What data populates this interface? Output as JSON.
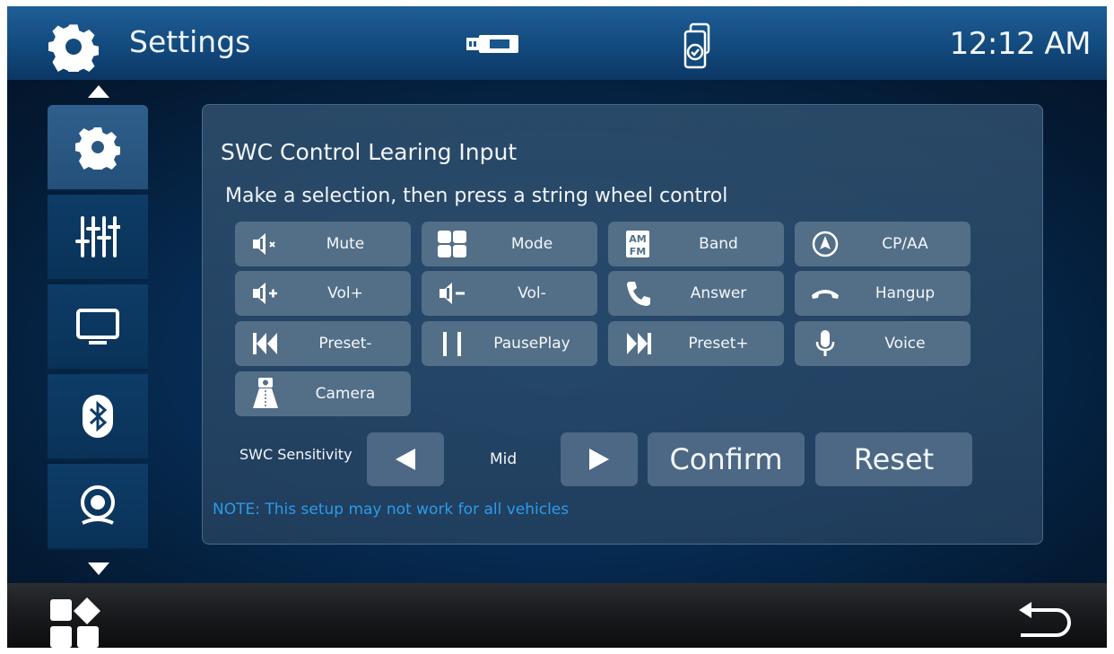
{
  "header": {
    "title": "Settings",
    "time": "12:12 AM",
    "icons": [
      "gear-icon",
      "usb-icon",
      "phone-link-icon"
    ]
  },
  "left_nav": {
    "items": [
      {
        "icon": "gear-icon",
        "active": true
      },
      {
        "icon": "equalizer-icon",
        "active": false
      },
      {
        "icon": "display-icon",
        "active": false
      },
      {
        "icon": "bluetooth-icon",
        "active": false
      },
      {
        "icon": "camera-icon",
        "active": false
      }
    ]
  },
  "panel": {
    "title": "SWC Control Learing Input",
    "subtitle": "Make a selection, then press a string wheel control",
    "buttons": [
      {
        "label": "Mute",
        "icon": "mute-icon"
      },
      {
        "label": "Mode",
        "icon": "mode-icon"
      },
      {
        "label": "Band",
        "icon": "am-fm-icon"
      },
      {
        "label": "CP/AA",
        "icon": "navigation-icon"
      },
      {
        "label": "Vol+",
        "icon": "volume-up-icon"
      },
      {
        "label": "Vol-",
        "icon": "volume-down-icon"
      },
      {
        "label": "Answer",
        "icon": "phone-answer-icon"
      },
      {
        "label": "Hangup",
        "icon": "phone-hangup-icon"
      },
      {
        "label": "Preset-",
        "icon": "skip-back-icon"
      },
      {
        "label": "PausePlay",
        "icon": "pause-icon"
      },
      {
        "label": "Preset+",
        "icon": "skip-forward-icon"
      },
      {
        "label": "Voice",
        "icon": "microphone-icon"
      },
      {
        "label": "Camera",
        "icon": "rear-camera-icon"
      }
    ],
    "sensitivity": {
      "label": "SWC Sensitivity",
      "value": "Mid"
    },
    "confirm_label": "Confirm",
    "reset_label": "Reset",
    "note": "NOTE: This setup may not work for all vehicles"
  },
  "bottom_bar": {
    "icons": [
      "apps-icon",
      "back-icon"
    ]
  },
  "colors": {
    "accent_note": "#2d9be8",
    "button_bg": "#536f88",
    "header_bg": "#1a578e"
  }
}
